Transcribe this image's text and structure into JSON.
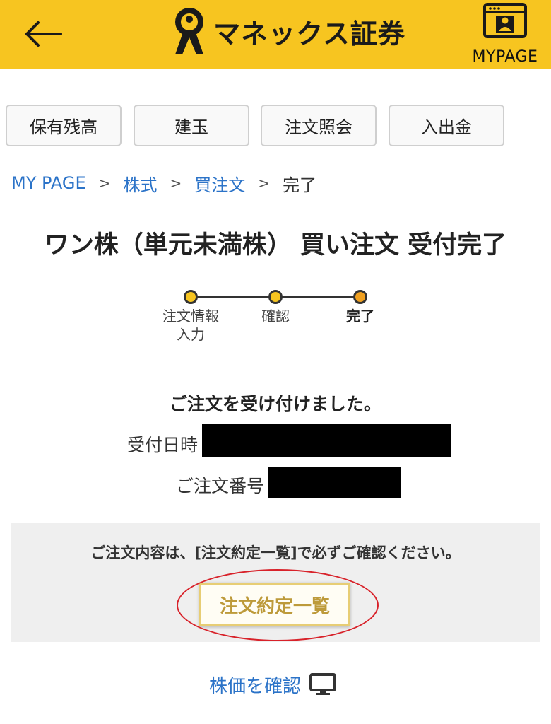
{
  "header": {
    "logo_text": "マネックス証券",
    "mypage_label": "MYPAGE"
  },
  "tabs": [
    {
      "label": "保有残高"
    },
    {
      "label": "建玉"
    },
    {
      "label": "注文照会"
    },
    {
      "label": "入出金"
    }
  ],
  "breadcrumb": {
    "items": [
      "MY PAGE",
      "株式",
      "買注文"
    ],
    "separator": ">",
    "current": "完了"
  },
  "page_title": "ワン株（単元未満株） 買い注文 受付完了",
  "steps": [
    {
      "label": "注文情報入力",
      "state": "done"
    },
    {
      "label": "確認",
      "state": "done"
    },
    {
      "label": "完了",
      "state": "current"
    }
  ],
  "result": {
    "message": "ご注文を受け付けました。",
    "received_label": "受付日時",
    "order_no_label": "ご注文番号"
  },
  "notice": {
    "text": "ご注文内容は、[注文約定一覧]で必ずご確認ください。",
    "button_label": "注文約定一覧"
  },
  "price_link": "株価を確認",
  "colors": {
    "brand_yellow": "#f7c520",
    "link_blue": "#2b73c8",
    "step_done": "#f7c520",
    "step_current": "#f0a020",
    "annotation_red": "#d8222a"
  },
  "icons": [
    "back-arrow-icon",
    "logo-figure-icon",
    "profile-card-icon",
    "monitor-icon"
  ]
}
